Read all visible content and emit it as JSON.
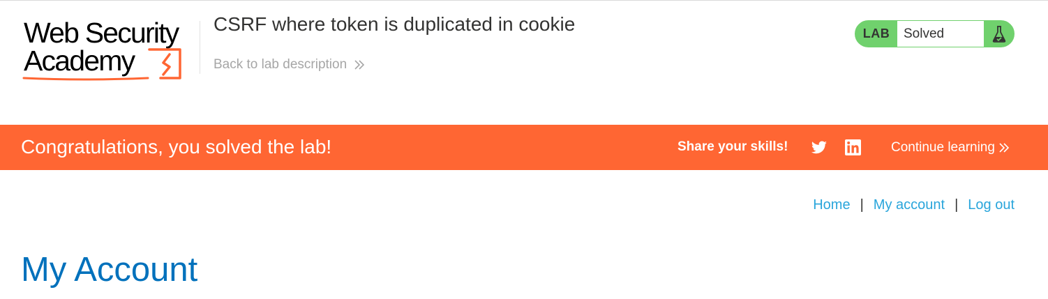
{
  "header": {
    "logo": {
      "line1": "Web Security",
      "line2": "Academy",
      "brand_color": "#ff6633"
    },
    "lab_title": "CSRF where token is duplicated in cookie",
    "back_link": "Back to lab description",
    "back_icon": "double-chevron-right-icon",
    "lab_status": {
      "label": "LAB",
      "status": "Solved",
      "icon": "flask-check-icon",
      "color": "#70d16d"
    }
  },
  "banner": {
    "message": "Congratulations, you solved the lab!",
    "share_label": "Share your skills!",
    "share_icons": [
      "twitter-icon",
      "linkedin-icon"
    ],
    "continue_label": "Continue learning",
    "continue_icon": "double-chevron-right-icon",
    "color": "#ff6633"
  },
  "nav": {
    "items": [
      "Home",
      "My account",
      "Log out"
    ],
    "separator": "|",
    "link_color": "#29a5db"
  },
  "main": {
    "heading": "My Account",
    "heading_color": "#0071bc"
  }
}
